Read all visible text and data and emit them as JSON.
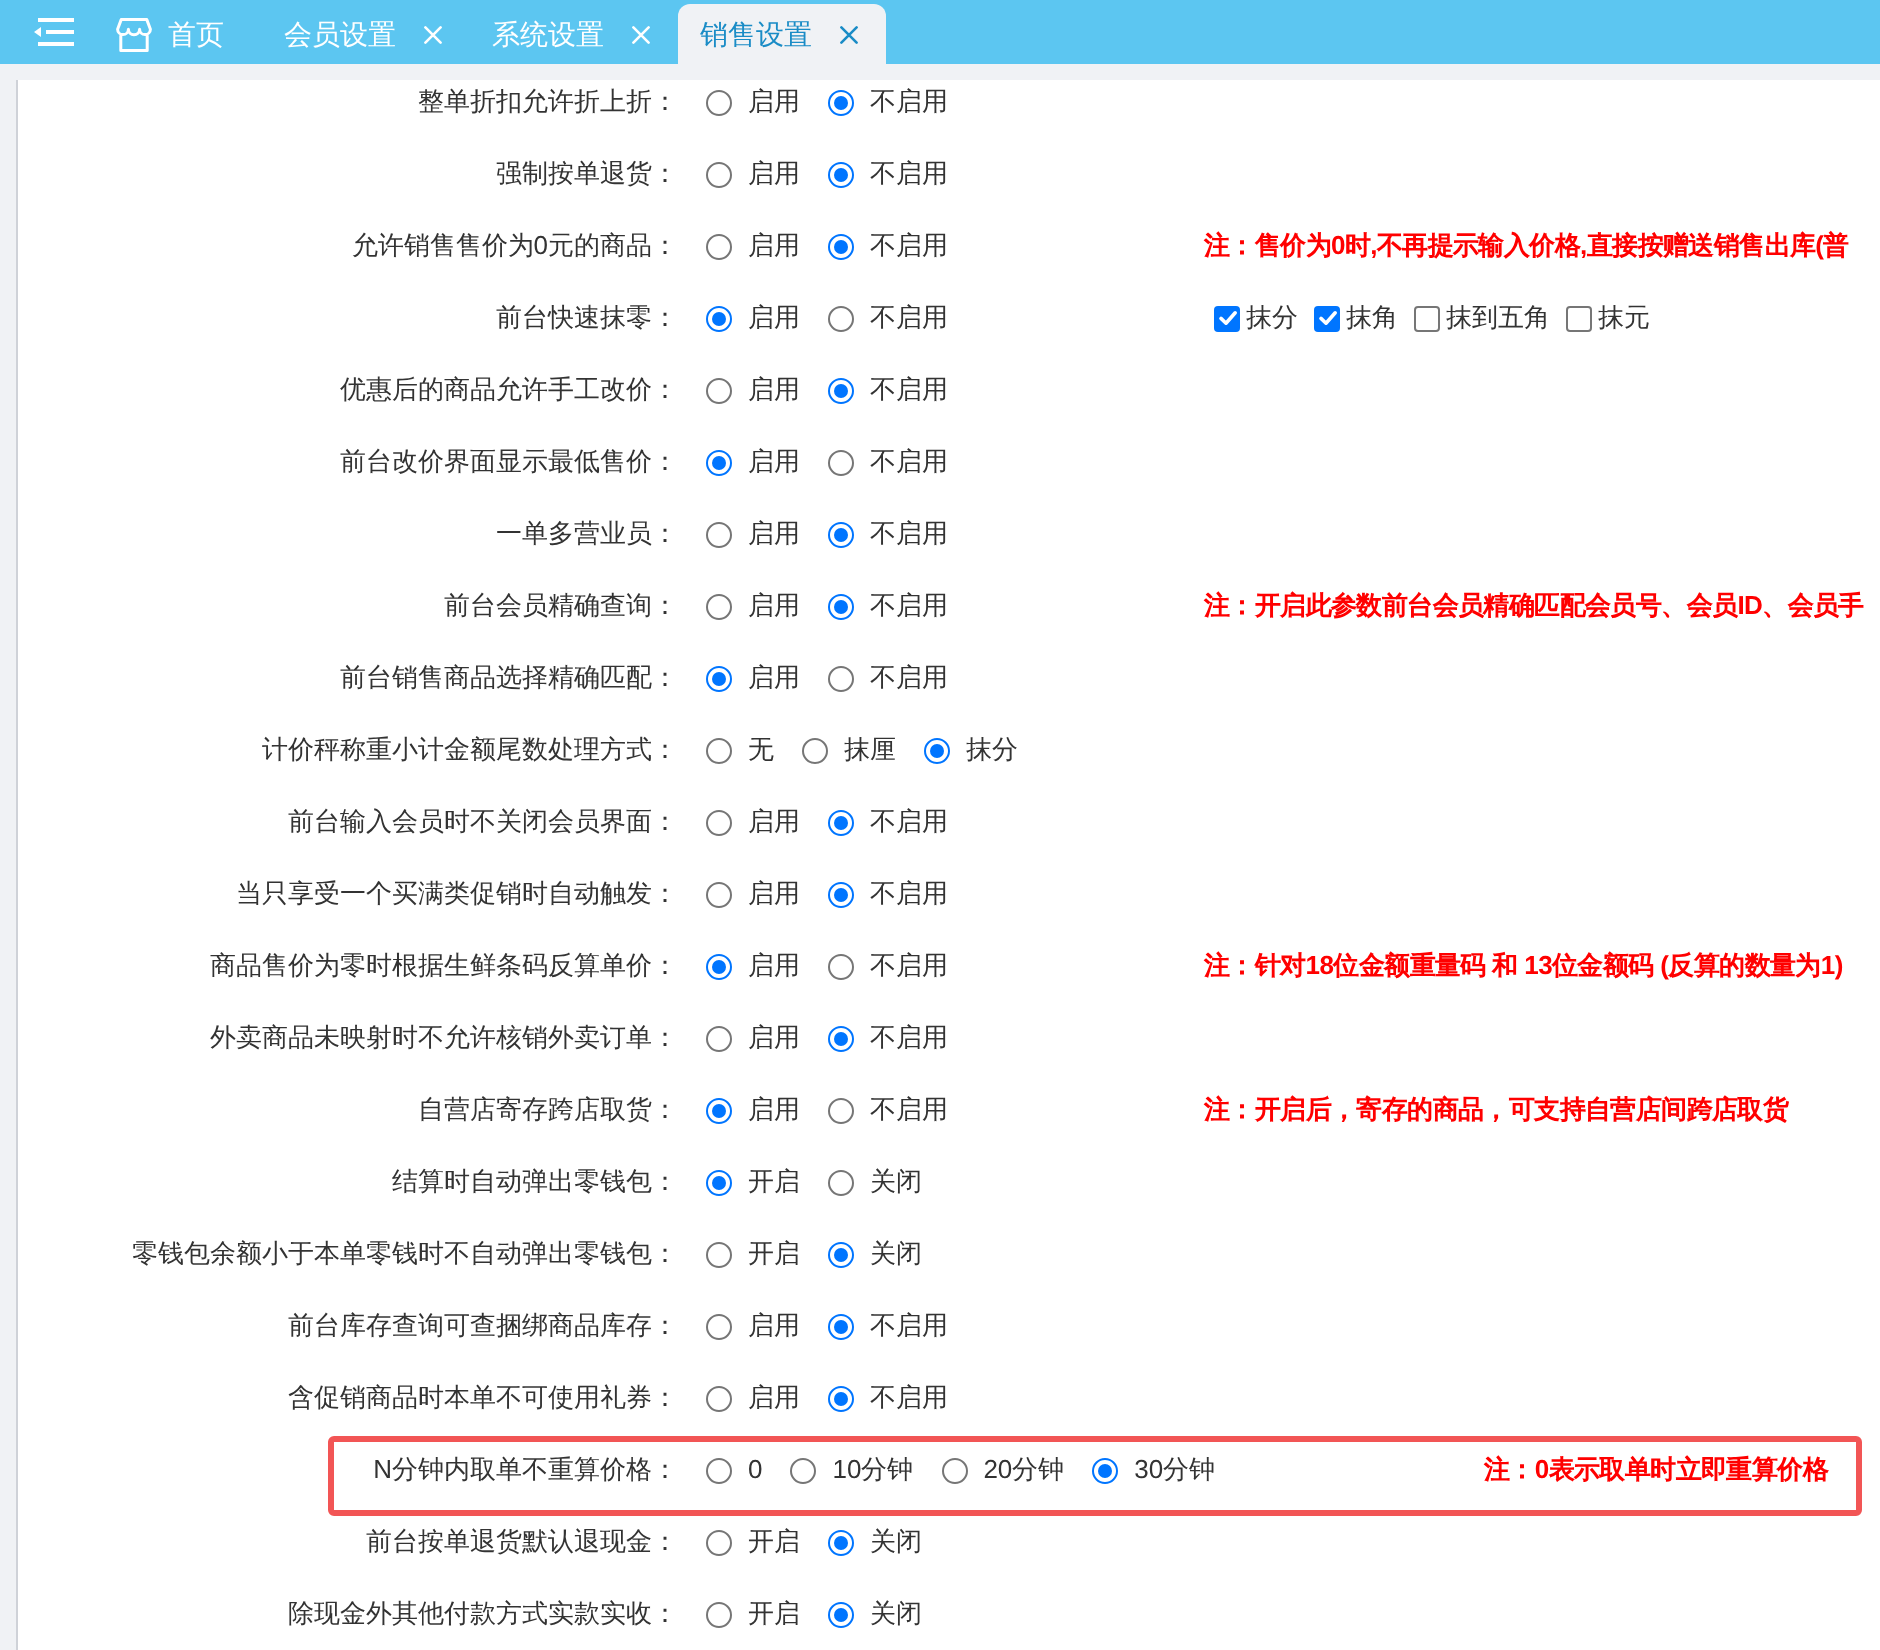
{
  "tab_bar": {
    "tabs": [
      {
        "label": "首页",
        "kind": "home",
        "selected": false,
        "closable": false
      },
      {
        "label": "会员设置",
        "kind": "page",
        "selected": false,
        "closable": true
      },
      {
        "label": "系统设置",
        "kind": "page",
        "selected": false,
        "closable": true
      },
      {
        "label": "销售设置",
        "kind": "page",
        "selected": true,
        "closable": true
      }
    ]
  },
  "settings": [
    {
      "label": "整单折扣允许折上折：",
      "highlighted": false,
      "options": [
        {
          "label": "启用",
          "selected": false
        },
        {
          "label": "不启用",
          "selected": true
        }
      ]
    },
    {
      "label": "强制按单退货：",
      "highlighted": false,
      "options": [
        {
          "label": "启用",
          "selected": false
        },
        {
          "label": "不启用",
          "selected": true
        }
      ]
    },
    {
      "label": "允许销售售价为0元的商品：",
      "highlighted": false,
      "options": [
        {
          "label": "启用",
          "selected": false
        },
        {
          "label": "不启用",
          "selected": true
        }
      ],
      "note": "注：售价为0时,不再提示输入价格,直接按赠送销售出库(普"
    },
    {
      "label": "前台快速抹零：",
      "highlighted": false,
      "options": [
        {
          "label": "启用",
          "selected": true
        },
        {
          "label": "不启用",
          "selected": false
        }
      ],
      "checkboxes": [
        {
          "label": "抹分",
          "checked": true
        },
        {
          "label": "抹角",
          "checked": true
        },
        {
          "label": "抹到五角",
          "checked": false
        },
        {
          "label": "抹元",
          "checked": false
        }
      ]
    },
    {
      "label": "优惠后的商品允许手工改价：",
      "highlighted": false,
      "options": [
        {
          "label": "启用",
          "selected": false
        },
        {
          "label": "不启用",
          "selected": true
        }
      ]
    },
    {
      "label": "前台改价界面显示最低售价：",
      "highlighted": false,
      "options": [
        {
          "label": "启用",
          "selected": true
        },
        {
          "label": "不启用",
          "selected": false
        }
      ]
    },
    {
      "label": "一单多营业员：",
      "highlighted": false,
      "options": [
        {
          "label": "启用",
          "selected": false
        },
        {
          "label": "不启用",
          "selected": true
        }
      ]
    },
    {
      "label": "前台会员精确查询：",
      "highlighted": false,
      "options": [
        {
          "label": "启用",
          "selected": false
        },
        {
          "label": "不启用",
          "selected": true
        }
      ],
      "note": "注：开启此参数前台会员精确匹配会员号、会员ID、会员手"
    },
    {
      "label": "前台销售商品选择精确匹配：",
      "highlighted": false,
      "options": [
        {
          "label": "启用",
          "selected": true
        },
        {
          "label": "不启用",
          "selected": false
        }
      ]
    },
    {
      "label": "计价秤称重小计金额尾数处理方式：",
      "highlighted": false,
      "options": [
        {
          "label": "无",
          "selected": false
        },
        {
          "label": "抹厘",
          "selected": false
        },
        {
          "label": "抹分",
          "selected": true
        }
      ]
    },
    {
      "label": "前台输入会员时不关闭会员界面：",
      "highlighted": false,
      "options": [
        {
          "label": "启用",
          "selected": false
        },
        {
          "label": "不启用",
          "selected": true
        }
      ]
    },
    {
      "label": "当只享受一个买满类促销时自动触发：",
      "highlighted": false,
      "options": [
        {
          "label": "启用",
          "selected": false
        },
        {
          "label": "不启用",
          "selected": true
        }
      ]
    },
    {
      "label": "商品售价为零时根据生鲜条码反算单价：",
      "highlighted": false,
      "options": [
        {
          "label": "启用",
          "selected": true
        },
        {
          "label": "不启用",
          "selected": false
        }
      ],
      "note": "注：针对18位金额重量码 和 13位金额码 (反算的数量为1)"
    },
    {
      "label": "外卖商品未映射时不允许核销外卖订单：",
      "highlighted": false,
      "options": [
        {
          "label": "启用",
          "selected": false
        },
        {
          "label": "不启用",
          "selected": true
        }
      ]
    },
    {
      "label": "自营店寄存跨店取货：",
      "highlighted": false,
      "options": [
        {
          "label": "启用",
          "selected": true
        },
        {
          "label": "不启用",
          "selected": false
        }
      ],
      "note": "注：开启后，寄存的商品，可支持自营店间跨店取货"
    },
    {
      "label": "结算时自动弹出零钱包：",
      "highlighted": false,
      "options": [
        {
          "label": "开启",
          "selected": true
        },
        {
          "label": "关闭",
          "selected": false
        }
      ]
    },
    {
      "label": "零钱包余额小于本单零钱时不自动弹出零钱包：",
      "highlighted": false,
      "options": [
        {
          "label": "开启",
          "selected": false
        },
        {
          "label": "关闭",
          "selected": true
        }
      ]
    },
    {
      "label": "前台库存查询可查捆绑商品库存：",
      "highlighted": false,
      "options": [
        {
          "label": "启用",
          "selected": false
        },
        {
          "label": "不启用",
          "selected": true
        }
      ]
    },
    {
      "label": "含促销商品时本单不可使用礼券：",
      "highlighted": false,
      "options": [
        {
          "label": "启用",
          "selected": false
        },
        {
          "label": "不启用",
          "selected": true
        }
      ]
    },
    {
      "label": "N分钟内取单不重算价格：",
      "highlighted": true,
      "options": [
        {
          "label": "0",
          "selected": false
        },
        {
          "label": "10分钟",
          "selected": false
        },
        {
          "label": "20分钟",
          "selected": false
        },
        {
          "label": "30分钟",
          "selected": true
        }
      ],
      "note": "注：0表示取单时立即重算价格"
    },
    {
      "label": "前台按单退货默认退现金：",
      "highlighted": false,
      "options": [
        {
          "label": "开启",
          "selected": false
        },
        {
          "label": "关闭",
          "selected": true
        }
      ]
    },
    {
      "label": "除现金外其他付款方式实款实收：",
      "highlighted": false,
      "options": [
        {
          "label": "开启",
          "selected": false
        },
        {
          "label": "关闭",
          "selected": true
        }
      ]
    }
  ]
}
